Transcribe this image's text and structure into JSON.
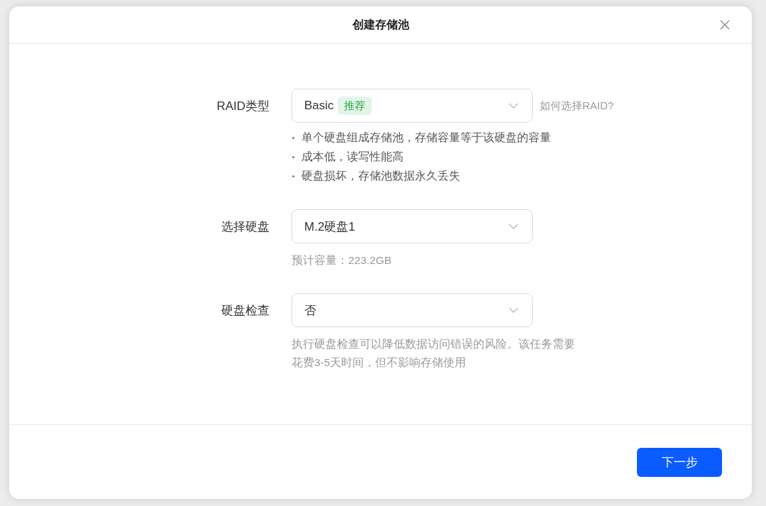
{
  "dialog": {
    "title": "创建存储池"
  },
  "fields": [
    {
      "label": "RAID类型",
      "value": "Basic",
      "tag": "推荐",
      "help_link": "如何选择RAID?",
      "notes": [
        "单个硬盘组成存储池，存储容量等于该硬盘的容量",
        "成本低，读写性能高",
        "硬盘损坏，存储池数据永久丢失"
      ]
    },
    {
      "label": "选择硬盘",
      "value": "M.2硬盘1",
      "hint": "预计容量：223.2GB"
    },
    {
      "label": "硬盘检查",
      "value": "否",
      "hint": "执行硬盘检查可以降低数据访问错误的风险。该任务需要花费3-5天时间，但不影响存储使用"
    }
  ],
  "footer": {
    "primary_button": "下一步"
  }
}
